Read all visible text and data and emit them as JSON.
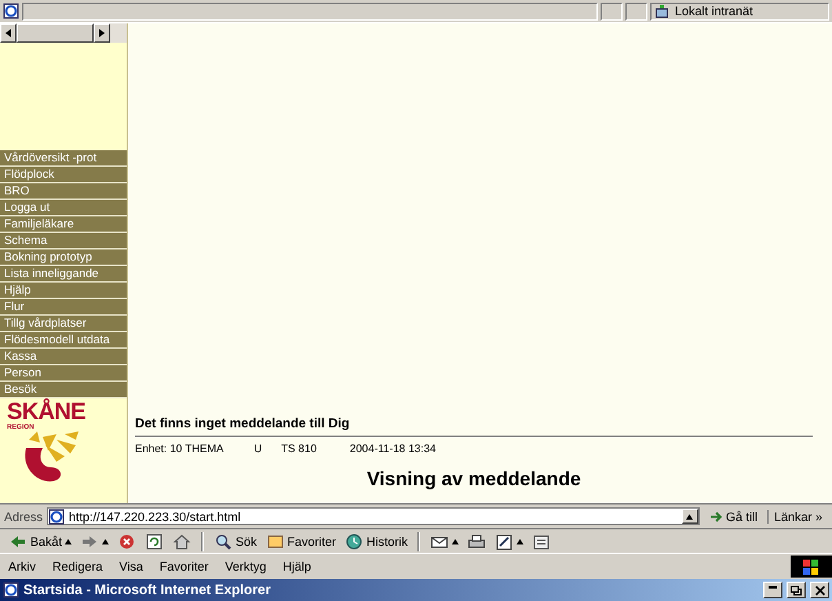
{
  "status_bar": {
    "zone": "Lokalt intranät"
  },
  "sidebar": {
    "items": [
      "Vårdöversikt -prot",
      "Flödplock",
      "BRO",
      "Logga ut",
      "Familjeläkare",
      "Schema",
      "Bokning prototyp",
      "Lista inneliggande",
      "Hjälp",
      "Flur",
      "Tillg vårdplatser",
      "Flödesmodell utdata",
      "Kassa",
      "Person",
      "Besök"
    ]
  },
  "logo": {
    "name": "SKÅNE",
    "tag": "REGION"
  },
  "content": {
    "message": "Det finns inget meddelande till Dig",
    "meta": [
      "Enhet: 10 THEMA",
      "U",
      "TS 810",
      "2004-11-18 13:34"
    ],
    "title": "Visning av meddelande"
  },
  "address": {
    "label": "Adress",
    "value": "http://147.220.223.30/start.html",
    "go": "Gå till",
    "links": "Länkar »"
  },
  "toolbar": [
    {
      "kind": "back",
      "label": "Bakåt"
    },
    {
      "kind": "forward"
    },
    {
      "kind": "stop"
    },
    {
      "kind": "refresh"
    },
    {
      "kind": "home"
    },
    {
      "kind": "search",
      "label": "Sök"
    },
    {
      "kind": "favorites",
      "label": "Favoriter"
    },
    {
      "kind": "history",
      "label": "Historik"
    },
    {
      "kind": "mail"
    },
    {
      "kind": "print"
    },
    {
      "kind": "edit"
    },
    {
      "kind": "discuss"
    }
  ],
  "menu": [
    "Arkiv",
    "Redigera",
    "Visa",
    "Favoriter",
    "Verktyg",
    "Hjälp"
  ],
  "window": {
    "title": "Startsida - Microsoft Internet Explorer"
  }
}
